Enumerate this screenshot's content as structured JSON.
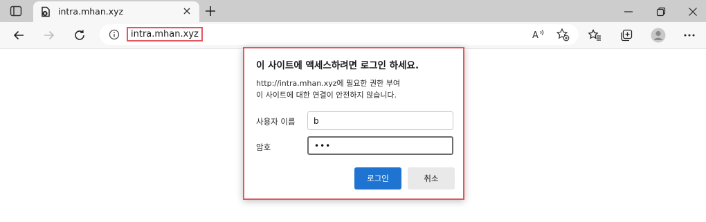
{
  "tab": {
    "title": "intra.mhan.xyz"
  },
  "address_bar": {
    "url": "intra.mhan.xyz"
  },
  "dialog": {
    "title": "이 사이트에 액세스하려면 로그인 하세요.",
    "message_line1": "http://intra.mhan.xyz에 필요한 권한 부여",
    "message_line2": "이 사이트에 대한 연결이 안전하지 않습니다.",
    "username_label": "사용자 이름",
    "username_value": "b",
    "password_label": "암호",
    "password_value": "•••",
    "login_button": "로그인",
    "cancel_button": "취소"
  },
  "colors": {
    "accent": "#1e74d0",
    "highlight": "#e2565f"
  },
  "icons": [
    "tab-actions-icon",
    "favicon-icon",
    "close-tab-icon",
    "new-tab-icon",
    "minimize-icon",
    "restore-icon",
    "close-window-icon",
    "back-icon",
    "forward-icon",
    "refresh-icon",
    "site-info-icon",
    "read-aloud-icon",
    "add-favorite-icon",
    "favorites-icon",
    "collections-icon",
    "profile-icon",
    "more-icon"
  ]
}
